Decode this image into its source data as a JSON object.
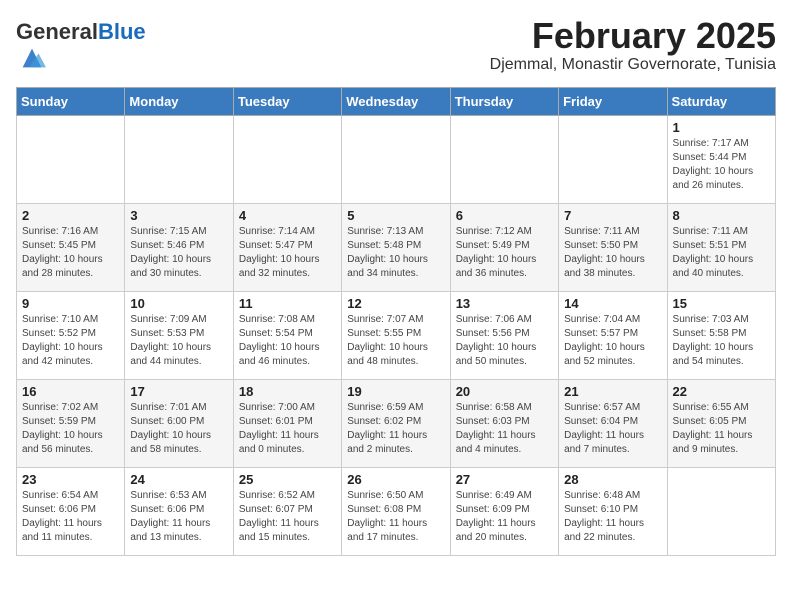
{
  "header": {
    "logo": {
      "general": "General",
      "blue": "Blue"
    },
    "title": "February 2025",
    "location": "Djemmal, Monastir Governorate, Tunisia"
  },
  "weekdays": [
    "Sunday",
    "Monday",
    "Tuesday",
    "Wednesday",
    "Thursday",
    "Friday",
    "Saturday"
  ],
  "weeks": [
    [
      {
        "day": "",
        "info": ""
      },
      {
        "day": "",
        "info": ""
      },
      {
        "day": "",
        "info": ""
      },
      {
        "day": "",
        "info": ""
      },
      {
        "day": "",
        "info": ""
      },
      {
        "day": "",
        "info": ""
      },
      {
        "day": "1",
        "info": "Sunrise: 7:17 AM\nSunset: 5:44 PM\nDaylight: 10 hours\nand 26 minutes."
      }
    ],
    [
      {
        "day": "2",
        "info": "Sunrise: 7:16 AM\nSunset: 5:45 PM\nDaylight: 10 hours\nand 28 minutes."
      },
      {
        "day": "3",
        "info": "Sunrise: 7:15 AM\nSunset: 5:46 PM\nDaylight: 10 hours\nand 30 minutes."
      },
      {
        "day": "4",
        "info": "Sunrise: 7:14 AM\nSunset: 5:47 PM\nDaylight: 10 hours\nand 32 minutes."
      },
      {
        "day": "5",
        "info": "Sunrise: 7:13 AM\nSunset: 5:48 PM\nDaylight: 10 hours\nand 34 minutes."
      },
      {
        "day": "6",
        "info": "Sunrise: 7:12 AM\nSunset: 5:49 PM\nDaylight: 10 hours\nand 36 minutes."
      },
      {
        "day": "7",
        "info": "Sunrise: 7:11 AM\nSunset: 5:50 PM\nDaylight: 10 hours\nand 38 minutes."
      },
      {
        "day": "8",
        "info": "Sunrise: 7:11 AM\nSunset: 5:51 PM\nDaylight: 10 hours\nand 40 minutes."
      }
    ],
    [
      {
        "day": "9",
        "info": "Sunrise: 7:10 AM\nSunset: 5:52 PM\nDaylight: 10 hours\nand 42 minutes."
      },
      {
        "day": "10",
        "info": "Sunrise: 7:09 AM\nSunset: 5:53 PM\nDaylight: 10 hours\nand 44 minutes."
      },
      {
        "day": "11",
        "info": "Sunrise: 7:08 AM\nSunset: 5:54 PM\nDaylight: 10 hours\nand 46 minutes."
      },
      {
        "day": "12",
        "info": "Sunrise: 7:07 AM\nSunset: 5:55 PM\nDaylight: 10 hours\nand 48 minutes."
      },
      {
        "day": "13",
        "info": "Sunrise: 7:06 AM\nSunset: 5:56 PM\nDaylight: 10 hours\nand 50 minutes."
      },
      {
        "day": "14",
        "info": "Sunrise: 7:04 AM\nSunset: 5:57 PM\nDaylight: 10 hours\nand 52 minutes."
      },
      {
        "day": "15",
        "info": "Sunrise: 7:03 AM\nSunset: 5:58 PM\nDaylight: 10 hours\nand 54 minutes."
      }
    ],
    [
      {
        "day": "16",
        "info": "Sunrise: 7:02 AM\nSunset: 5:59 PM\nDaylight: 10 hours\nand 56 minutes."
      },
      {
        "day": "17",
        "info": "Sunrise: 7:01 AM\nSunset: 6:00 PM\nDaylight: 10 hours\nand 58 minutes."
      },
      {
        "day": "18",
        "info": "Sunrise: 7:00 AM\nSunset: 6:01 PM\nDaylight: 11 hours\nand 0 minutes."
      },
      {
        "day": "19",
        "info": "Sunrise: 6:59 AM\nSunset: 6:02 PM\nDaylight: 11 hours\nand 2 minutes."
      },
      {
        "day": "20",
        "info": "Sunrise: 6:58 AM\nSunset: 6:03 PM\nDaylight: 11 hours\nand 4 minutes."
      },
      {
        "day": "21",
        "info": "Sunrise: 6:57 AM\nSunset: 6:04 PM\nDaylight: 11 hours\nand 7 minutes."
      },
      {
        "day": "22",
        "info": "Sunrise: 6:55 AM\nSunset: 6:05 PM\nDaylight: 11 hours\nand 9 minutes."
      }
    ],
    [
      {
        "day": "23",
        "info": "Sunrise: 6:54 AM\nSunset: 6:06 PM\nDaylight: 11 hours\nand 11 minutes."
      },
      {
        "day": "24",
        "info": "Sunrise: 6:53 AM\nSunset: 6:06 PM\nDaylight: 11 hours\nand 13 minutes."
      },
      {
        "day": "25",
        "info": "Sunrise: 6:52 AM\nSunset: 6:07 PM\nDaylight: 11 hours\nand 15 minutes."
      },
      {
        "day": "26",
        "info": "Sunrise: 6:50 AM\nSunset: 6:08 PM\nDaylight: 11 hours\nand 17 minutes."
      },
      {
        "day": "27",
        "info": "Sunrise: 6:49 AM\nSunset: 6:09 PM\nDaylight: 11 hours\nand 20 minutes."
      },
      {
        "day": "28",
        "info": "Sunrise: 6:48 AM\nSunset: 6:10 PM\nDaylight: 11 hours\nand 22 minutes."
      },
      {
        "day": "",
        "info": ""
      }
    ]
  ]
}
